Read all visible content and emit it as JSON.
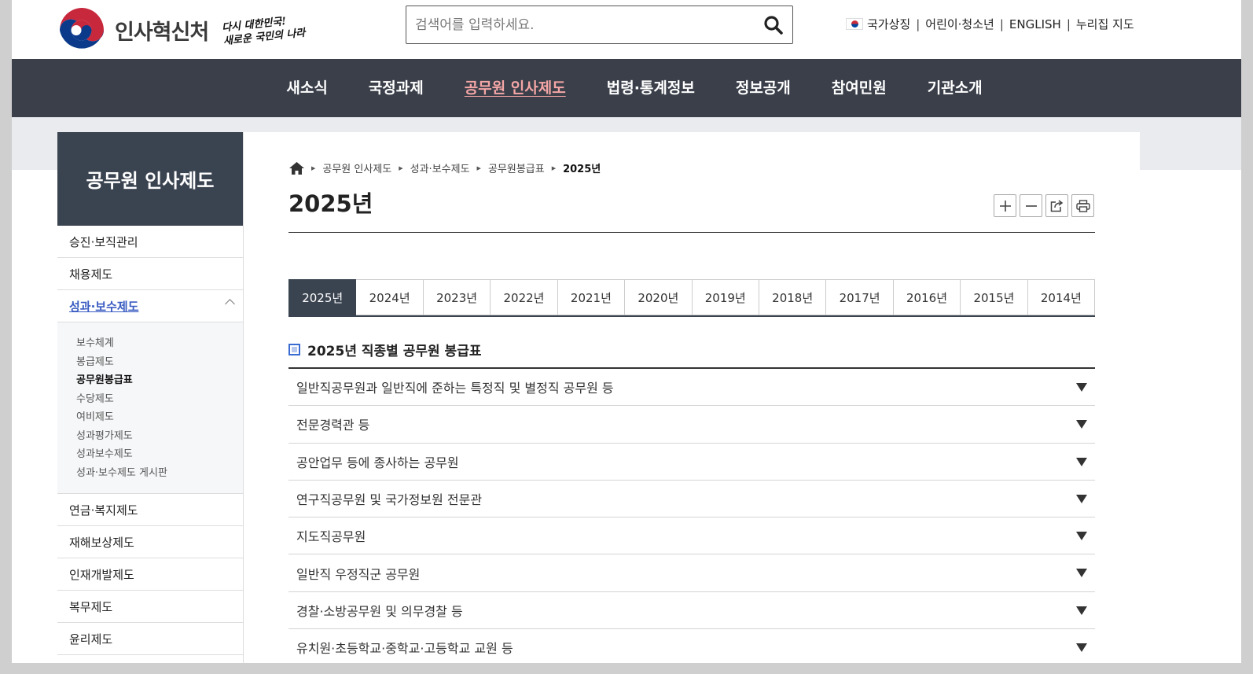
{
  "header": {
    "org_name": "인사혁신처",
    "slogan_line1": "다시 대한민국!",
    "slogan_line2": "새로운 국민의 나라",
    "search": {
      "placeholder": "검색어를 입력하세요."
    },
    "util_links": [
      "국가상징",
      "어린이·청소년",
      "ENGLISH",
      "누리집 지도"
    ]
  },
  "gnb": [
    {
      "label": "새소식",
      "active": false
    },
    {
      "label": "국정과제",
      "active": false
    },
    {
      "label": "공무원 인사제도",
      "active": true
    },
    {
      "label": "법령·통계정보",
      "active": false
    },
    {
      "label": "정보공개",
      "active": false
    },
    {
      "label": "참여민원",
      "active": false
    },
    {
      "label": "기관소개",
      "active": false
    }
  ],
  "lnb": {
    "title": "공무원 인사제도",
    "items_before": [
      "승진·보직관리",
      "채용제도"
    ],
    "open_item": "성과·보수제도",
    "sub_items": [
      "보수체계",
      "봉급제도",
      "공무원봉급표",
      "수당제도",
      "여비제도",
      "성과평가제도",
      "성과보수제도",
      "성과·보수제도 게시판"
    ],
    "current_sub": "공무원봉급표",
    "items_after": [
      "연금·복지제도",
      "재해보상제도",
      "인재개발제도",
      "복무제도",
      "윤리제도"
    ]
  },
  "breadcrumb": [
    "공무원 인사제도",
    "성과·보수제도",
    "공무원봉급표",
    "2025년"
  ],
  "page_title": "2025년",
  "tools": [
    "zoom-in",
    "zoom-out",
    "share",
    "print"
  ],
  "tabs": [
    "2025년",
    "2024년",
    "2023년",
    "2022년",
    "2021년",
    "2020년",
    "2019년",
    "2018년",
    "2017년",
    "2016년",
    "2015년",
    "2014년"
  ],
  "active_tab": "2025년",
  "section_title": "2025년 직종별 공무원 봉급표",
  "accordion": [
    "일반직공무원과 일반직에 준하는 특정직 및 별정직 공무원 등",
    "전문경력관 등",
    "공안업무 등에 종사하는 공무원",
    "연구직공무원 및 국가정보원 전문관",
    "지도직공무원",
    "일반직 우정직군 공무원",
    "경찰·소방공무원 및 의무경찰 등",
    "유치원·초등학교·중학교·고등학교 교원 등"
  ]
}
